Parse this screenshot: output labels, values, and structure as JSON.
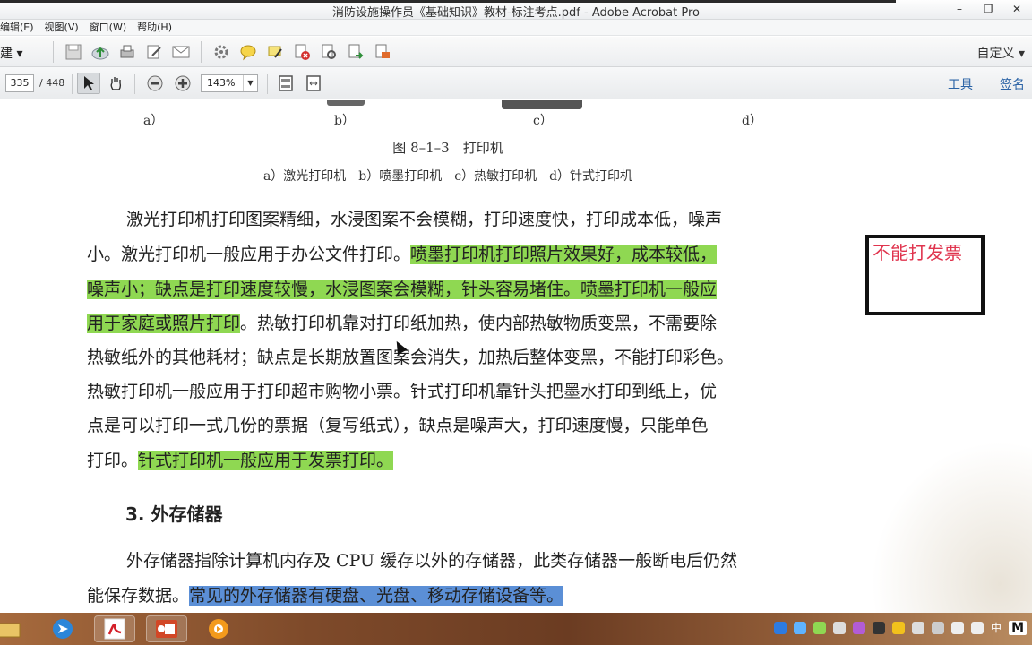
{
  "window": {
    "title": "消防设施操作员《基础知识》教材-标注考点.pdf - Adobe Acrobat Pro",
    "minimize": "–",
    "restore": "❐",
    "close": "✕"
  },
  "menu": {
    "items": [
      "编辑(E)",
      "视图(V)",
      "窗口(W)",
      "帮助(H)"
    ]
  },
  "toolbar": {
    "create_label": "建 ▾",
    "custom_label": "自定义 ▾",
    "icons": [
      "save-icon",
      "upload-icon",
      "print-icon",
      "edit-icon",
      "mail-icon",
      "settings-icon",
      "comment-icon",
      "highlight-icon",
      "delete-icon",
      "protect-icon",
      "export-icon",
      "redact-icon"
    ]
  },
  "nav": {
    "current_page": "335",
    "total_pages": "/ 448",
    "zoom": "143%",
    "tools_label": "工具",
    "sign_label": "签名"
  },
  "document": {
    "sub_labels": [
      "a）",
      "b）",
      "c）",
      "d）"
    ],
    "figure_title": "图 8–1–3　打印机",
    "figure_caption": "a）激光打印机　b）喷墨打印机　c）热敏打印机　d）针式打印机",
    "para1": {
      "line1": "激光打印机打印图案精细，水浸图案不会模糊，打印速度快，打印成本低，噪声",
      "line2_plain": "小。激光打印机一般应用于办公文件打印。",
      "line2_hl": "喷墨打印机打印照片效果好，成本较低，",
      "line3_hl": "噪声小；缺点是打印速度较慢，水浸图案会模糊，针头容易堵住。喷墨打印机一般应",
      "line4_hl": "用于家庭或照片打印",
      "line4_plain": "。热敏打印机靠对打印纸加热，使内部热敏物质变黑，不需要除",
      "line5": "热敏纸外的其他耗材；缺点是长期放置图案会消失，加热后整体变黑，不能打印彩色。",
      "line6": "热敏打印机一般应用于打印超市购物小票。针式打印机靠针头把墨水打印到纸上，优",
      "line7": "点是可以打印一式几份的票据（复写纸式），缺点是噪声大，打印速度慢，只能单色",
      "line8_plain": "打印。",
      "line8_hl": "针式打印机一般应用于发票打印。"
    },
    "section_heading": "3. 外存储器",
    "para2": {
      "line1": "外存储器指除计算机内存及 CPU 缓存以外的存储器，此类存储器一般断电后仍然",
      "line2_plain": "能保存数据。",
      "line2_hl": "常见的外存储器有硬盘、光盘、移动存储设备等。"
    },
    "annotation": "不能打发票"
  },
  "taskbar": {
    "apps": [
      "folder-icon",
      "browser-icon",
      "acrobat-icon",
      "powerpoint-icon",
      "media-icon"
    ],
    "ime": "中",
    "ime_m": "M"
  },
  "colors": {
    "highlight_green": "#8fd852",
    "highlight_blue": "#5b8fd6",
    "annotation_red": "#e0344e",
    "link_blue": "#2b63a6"
  }
}
